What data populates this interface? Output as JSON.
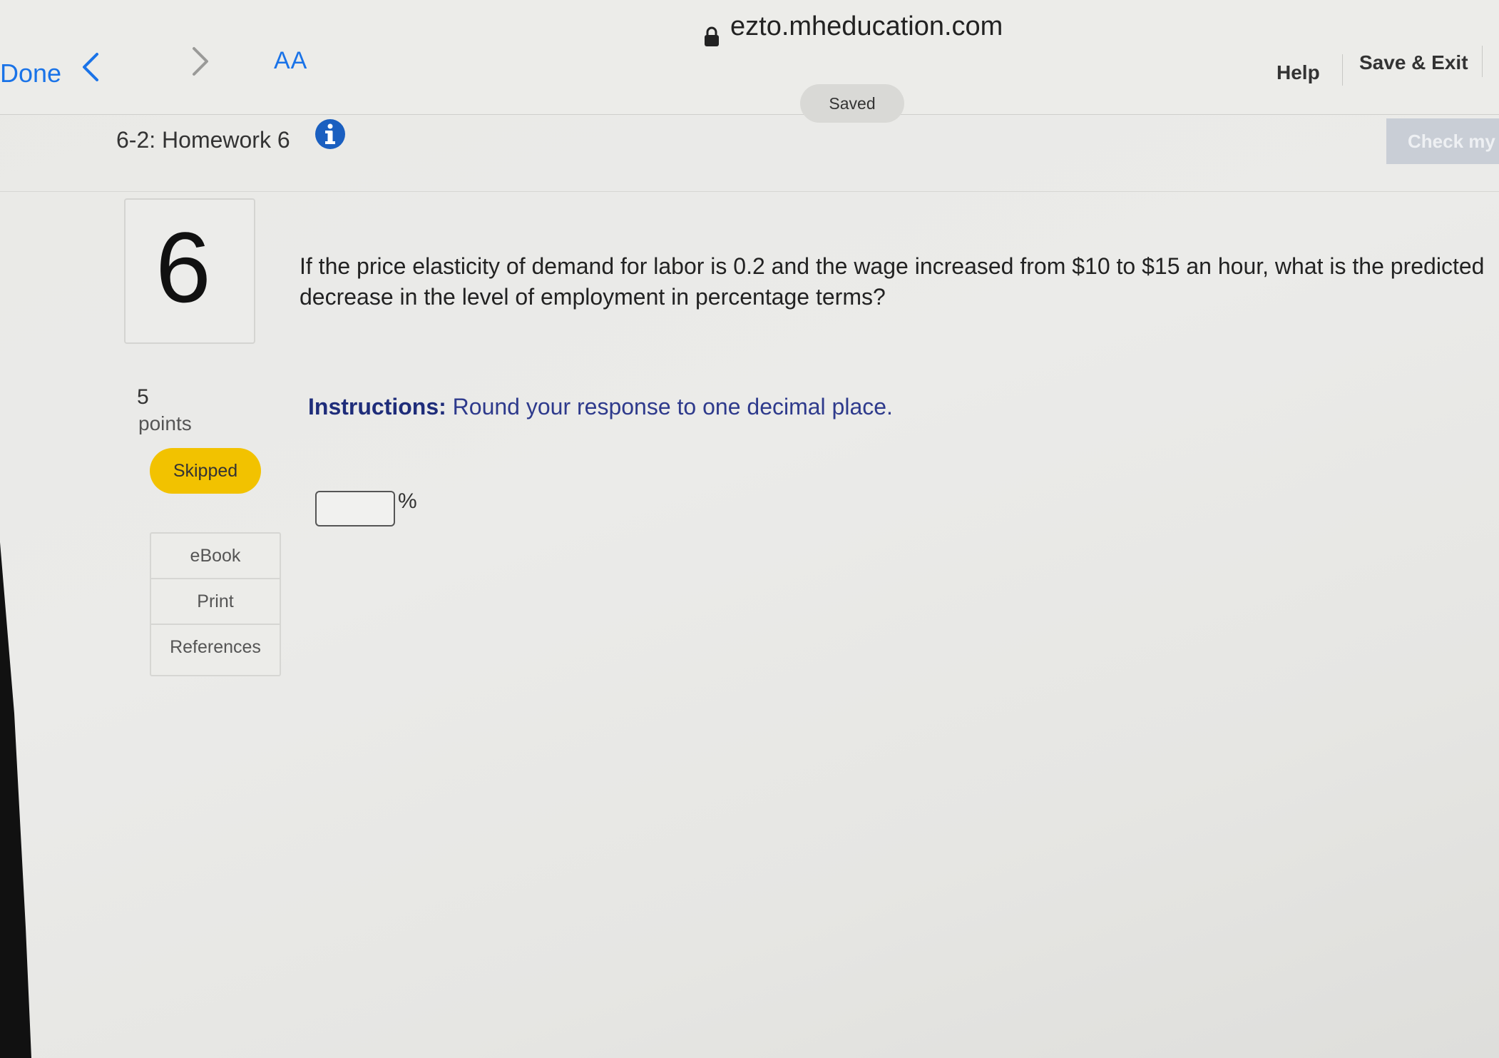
{
  "browser": {
    "done_label": "Done",
    "text_size_label": "AA",
    "url": "ezto.mheducation.com"
  },
  "header": {
    "saved_label": "Saved",
    "help_label": "Help",
    "save_exit_label": "Save & Exit",
    "assignment_title": "6-2: Homework 6",
    "check_button_label": "Check my"
  },
  "question": {
    "number": "6",
    "points_value": "5",
    "points_label": "points",
    "status_label": "Skipped",
    "text": "If the price elasticity of demand for labor is 0.2 and the wage increased from $10 to $15 an hour, what is the predicted decrease in the level of employment in percentage terms?",
    "instructions_bold": "Instructions:",
    "instructions_text": " Round your response to one decimal place.",
    "answer_value": "",
    "unit": "%"
  },
  "tools": {
    "ebook_label": "eBook",
    "print_label": "Print",
    "references_label": "References"
  },
  "colors": {
    "accent_blue": "#1a73e8",
    "skipped_yellow": "#f2c200",
    "instructions_navy": "#2e3a8c",
    "info_icon_blue": "#1a5fc0"
  }
}
